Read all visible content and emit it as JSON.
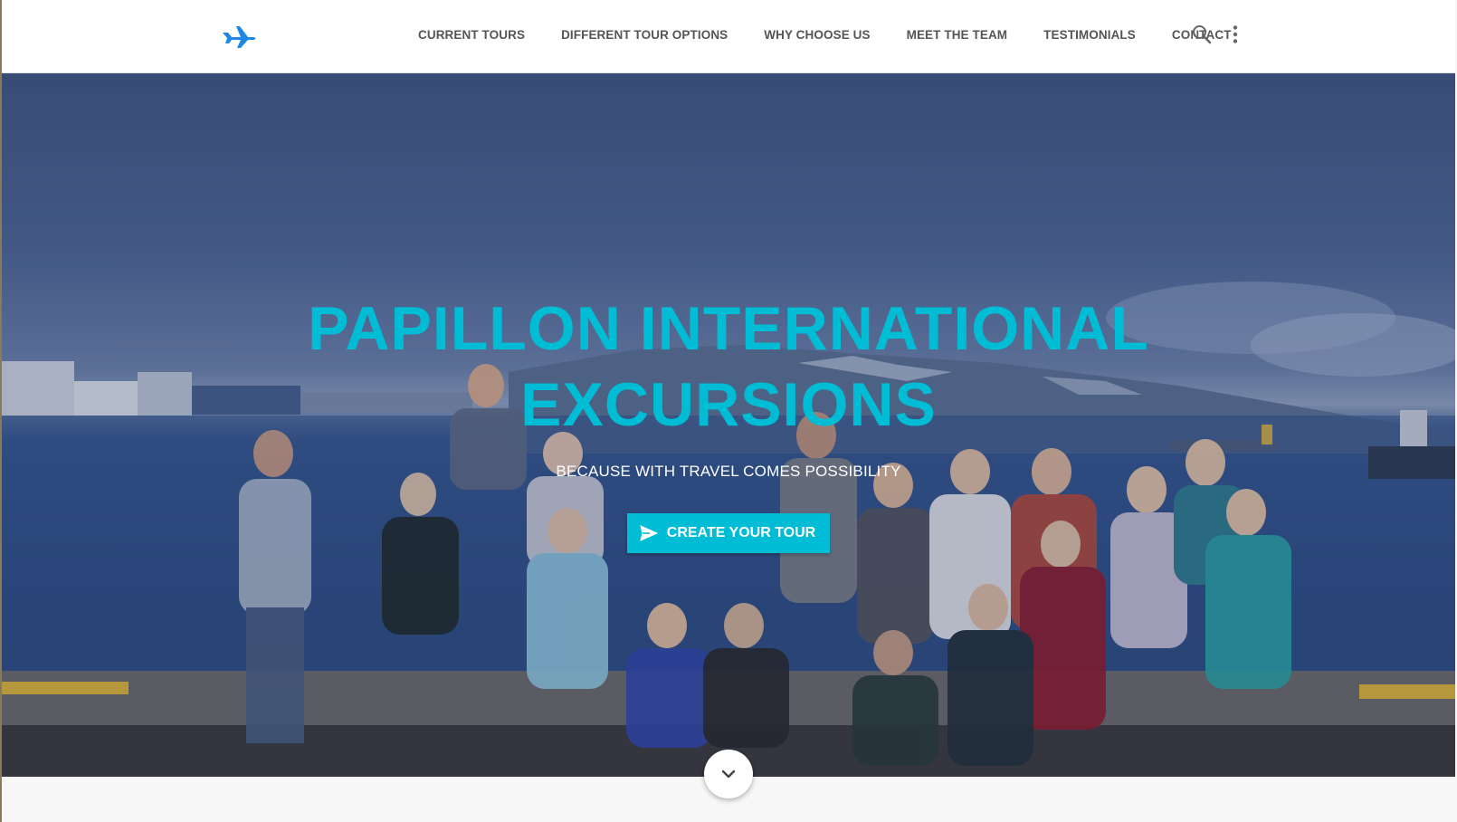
{
  "navbar": {
    "logo_icon": "airplane-icon",
    "links": [
      {
        "label": "CURRENT TOURS"
      },
      {
        "label": "DIFFERENT TOUR OPTIONS"
      },
      {
        "label": "WHY CHOOSE US"
      },
      {
        "label": "MEET THE TEAM"
      },
      {
        "label": "TESTIMONIALS"
      },
      {
        "label": "CONTACT"
      }
    ],
    "search_icon": "search-icon",
    "more_icon": "more-vert-icon"
  },
  "hero": {
    "title": "PAPILLON INTERNATIONAL EXCURSIONS",
    "subtitle": "BECAUSE WITH TRAVEL COMES POSSIBILITY",
    "cta_label": "CREATE YOUR TOUR",
    "cta_icon": "send-icon"
  },
  "scroll_icon": "chevron-down-icon",
  "colors": {
    "accent": "#00bcd4",
    "logo": "#1e88e5",
    "nav_text": "#555555"
  }
}
